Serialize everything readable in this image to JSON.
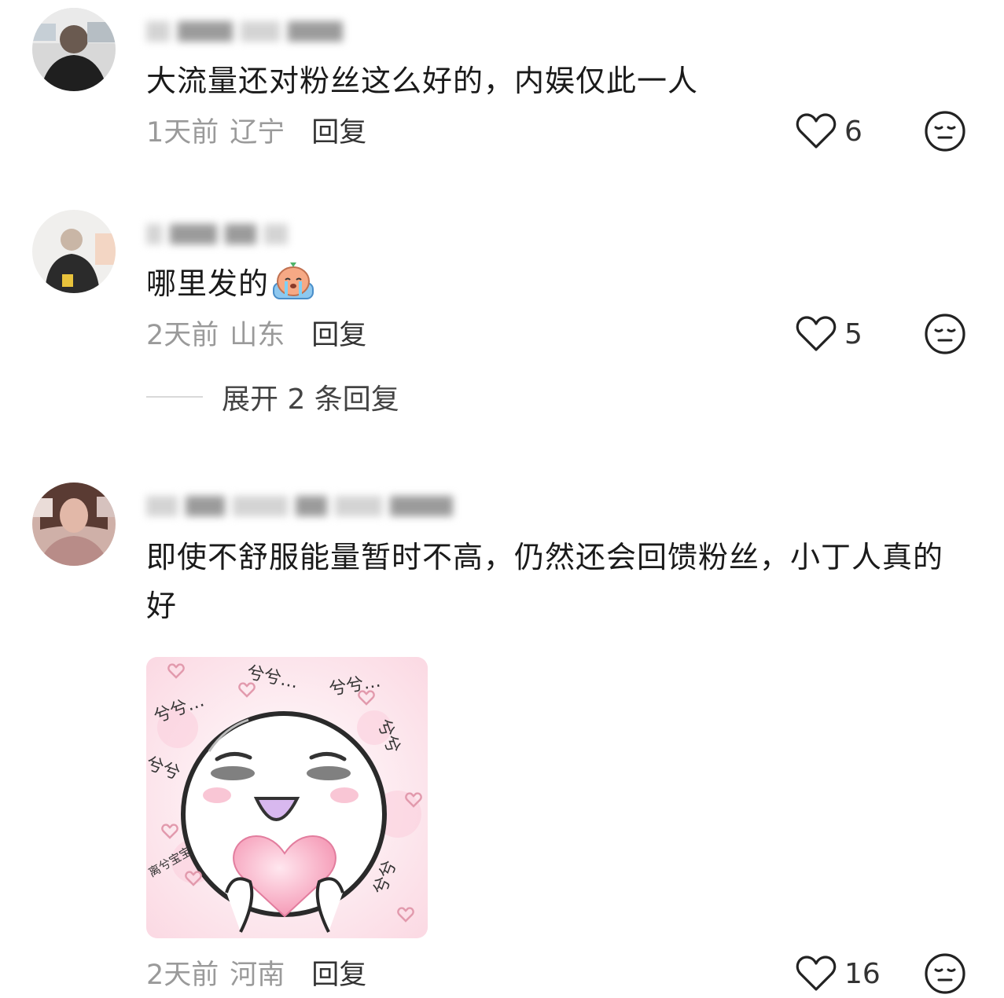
{
  "comments": [
    {
      "text": "大流量还对粉丝这么好的，内娱仅此一人",
      "time": "1天前",
      "location": "辽宁",
      "reply_label": "回复",
      "likes": "6"
    },
    {
      "text": "哪里发的",
      "time": "2天前",
      "location": "山东",
      "reply_label": "回复",
      "likes": "5",
      "expand_label": "展开 2 条回复"
    },
    {
      "text": "即使不舒服能量暂时不高，仍然还会回馈粉丝，小丁人真的好",
      "time": "2天前",
      "location": "河南",
      "reply_label": "回复",
      "likes": "16"
    }
  ],
  "sticker": {
    "labels": [
      "兮兮…",
      "兮兮…",
      "兮兮…",
      "兮兮",
      "兮兮",
      "兮兮",
      "离兮宝宝"
    ]
  },
  "icons": {
    "like": "heart-outline-icon",
    "dislike": "meh-face-icon",
    "inline_emoji": "crying-emoji-icon"
  },
  "colors": {
    "text": "#1a1a1a",
    "meta": "#9a9a9a",
    "sticker_pink": "#f7c6d4"
  }
}
